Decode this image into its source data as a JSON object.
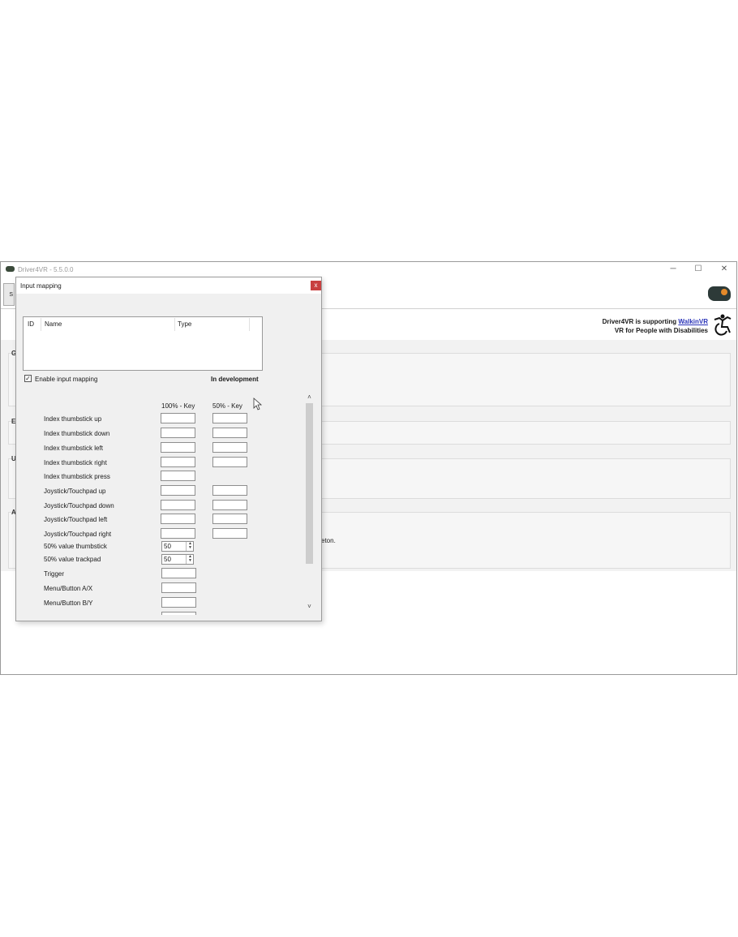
{
  "main_window": {
    "title": "Driver4VR - 5.5.0.0",
    "tab_label": "S",
    "buttons": {
      "minimize": "─",
      "maximize": "☐",
      "close": "✕"
    },
    "support": {
      "line1_prefix": "Driver4VR is supporting ",
      "line1_link": "WalkinVR",
      "line2": "VR for People with Disabilities"
    },
    "group_labels": [
      "G",
      "E",
      "U",
      "A"
    ],
    "partial_text": "eton."
  },
  "dialog": {
    "title": "Input mapping",
    "close_label": "x",
    "list_columns": [
      "ID",
      "Name",
      "Type"
    ],
    "enable_label": "Enable input mapping",
    "enable_checked": true,
    "status_text": "In development",
    "column_100": "100% - Key",
    "column_50": "50% - Key",
    "rows": [
      "Index thumbstick up",
      "Index thumbstick down",
      "Index thumbstick left",
      "Index thumbstick right",
      "Index thumbstick press",
      "Joystick/Touchpad up",
      "Joystick/Touchpad down",
      "Joystick/Touchpad left",
      "Joystick/Touchpad right"
    ],
    "value_thumbstick": {
      "label": "50% value thumbstick",
      "value": "50"
    },
    "value_trackpad": {
      "label": "50% value trackpad",
      "value": "50"
    },
    "buttons_rows": [
      "Trigger",
      "Menu/Button A/X",
      "Menu/Button B/Y"
    ]
  },
  "colors": {
    "accent_link": "#2a33b8",
    "close_button": "#c84040"
  }
}
